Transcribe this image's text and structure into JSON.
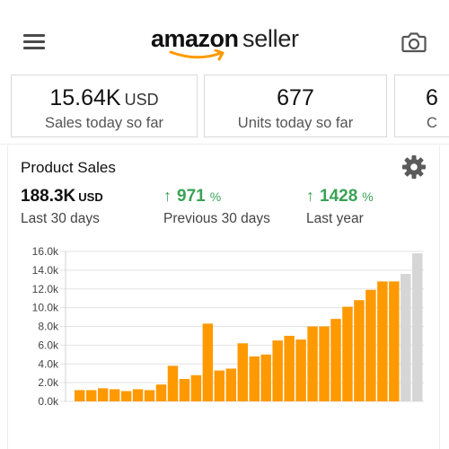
{
  "header": {
    "logo_word_1": "amazon",
    "logo_word_2": "seller",
    "menu_icon": "hamburger-menu-icon",
    "camera_icon": "camera-icon"
  },
  "cards": [
    {
      "value": "15.64K",
      "unit": "USD",
      "label": "Sales today so far"
    },
    {
      "value": "677",
      "unit": "",
      "label": "Units today so far"
    },
    {
      "value": "6",
      "unit": "",
      "label": "C"
    }
  ],
  "panel": {
    "title": "Product Sales",
    "gear_icon": "gear-icon",
    "stats": [
      {
        "value": "188.3K",
        "unit": "USD",
        "label": "Last 30 days"
      },
      {
        "arrow": "↑",
        "value": "971",
        "pct": "%",
        "label": "Previous 30 days"
      },
      {
        "arrow": "↑",
        "value": "1428",
        "pct": "%",
        "label": "Last year"
      }
    ]
  },
  "colors": {
    "bar": "#ff9900",
    "bar_projected": "#d6d6d6",
    "positive": "#3aa255",
    "grid": "#e3e3e3"
  },
  "chart_data": {
    "type": "bar",
    "title": "",
    "xlabel": "",
    "ylabel": "",
    "ylim": [
      0,
      16000
    ],
    "yticks": [
      "0.0k",
      "2.0k",
      "4.0k",
      "6.0k",
      "8.0k",
      "10.0k",
      "12.0k",
      "14.0k",
      "16.0k"
    ],
    "ytick_values": [
      0,
      2000,
      4000,
      6000,
      8000,
      10000,
      12000,
      14000,
      16000
    ],
    "grid": true,
    "values": [
      1200,
      1200,
      1400,
      1300,
      1100,
      1300,
      1200,
      1800,
      3800,
      2400,
      2800,
      8300,
      3300,
      3500,
      6200,
      4800,
      5000,
      6500,
      7000,
      6600,
      8000,
      8000,
      8800,
      10100,
      10800,
      11900,
      12800,
      12800,
      13600,
      15800
    ],
    "projected": [
      false,
      false,
      false,
      false,
      false,
      false,
      false,
      false,
      false,
      false,
      false,
      false,
      false,
      false,
      false,
      false,
      false,
      false,
      false,
      false,
      false,
      false,
      false,
      false,
      false,
      false,
      false,
      false,
      true,
      true
    ]
  }
}
